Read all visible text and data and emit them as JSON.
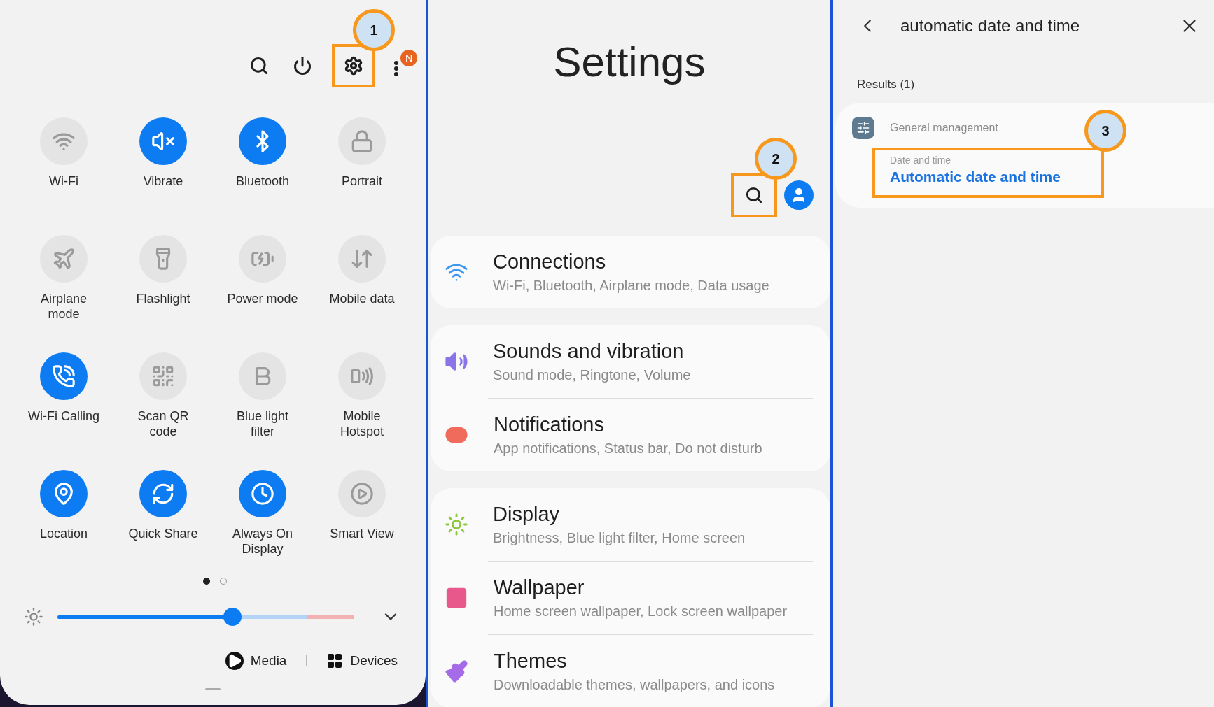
{
  "quick_panel": {
    "toolbar": {
      "callout": {
        "number": "1"
      },
      "notification_badge": "N"
    },
    "tiles": [
      {
        "kind": "wifi",
        "label": "Wi-Fi",
        "on": false
      },
      {
        "kind": "vibrate",
        "label": "Vibrate",
        "on": true
      },
      {
        "kind": "bluetooth",
        "label": "Bluetooth",
        "on": true
      },
      {
        "kind": "portrait",
        "label": "Portrait",
        "on": false
      },
      {
        "kind": "airplane",
        "label": "Airplane mode",
        "on": false
      },
      {
        "kind": "flashlight",
        "label": "Flashlight",
        "on": false
      },
      {
        "kind": "power",
        "label": "Power mode",
        "on": false
      },
      {
        "kind": "data",
        "label": "Mobile data",
        "on": false
      },
      {
        "kind": "wificall",
        "label": "Wi-Fi Calling",
        "on": true
      },
      {
        "kind": "qr",
        "label": "Scan QR code",
        "on": false
      },
      {
        "kind": "bluelight",
        "label": "Blue light filter",
        "on": false
      },
      {
        "kind": "hotspot",
        "label": "Mobile Hotspot",
        "on": false
      },
      {
        "kind": "location",
        "label": "Location",
        "on": true
      },
      {
        "kind": "share",
        "label": "Quick Share",
        "on": true
      },
      {
        "kind": "aod",
        "label": "Always On Display",
        "on": true
      },
      {
        "kind": "smartview",
        "label": "Smart View",
        "on": false
      }
    ],
    "pages": [
      {
        "selected": true
      },
      {
        "selected": false
      }
    ],
    "brightness": {
      "level": 0.59
    },
    "media_label": "Media",
    "devices_label": "Devices"
  },
  "settings_home": {
    "title": "Settings",
    "search_callout": {
      "number": "2"
    },
    "groups": [
      {
        "items": [
          {
            "kind": "connections",
            "title": "Connections",
            "subtitle": "Wi-Fi, Bluetooth, Airplane mode, Data usage"
          }
        ]
      },
      {
        "items": [
          {
            "kind": "sounds",
            "title": "Sounds and vibration",
            "subtitle": "Sound mode, Ringtone, Volume"
          },
          {
            "kind": "notifications",
            "title": "Notifications",
            "subtitle": "App notifications, Status bar, Do not disturb"
          }
        ]
      },
      {
        "items": [
          {
            "kind": "display",
            "title": "Display",
            "subtitle": "Brightness, Blue light filter, Home screen"
          },
          {
            "kind": "wallpaper",
            "title": "Wallpaper",
            "subtitle": "Home screen wallpaper, Lock screen wallpaper"
          },
          {
            "kind": "themes",
            "title": "Themes",
            "subtitle": "Downloadable themes, wallpapers, and icons"
          }
        ]
      }
    ]
  },
  "search_results": {
    "query": "automatic date and time",
    "results_label": "Results (1)",
    "results": [
      {
        "category": "General management",
        "path": "Date and time",
        "title": "Automatic date and time",
        "callout": {
          "number": "3"
        }
      }
    ]
  }
}
